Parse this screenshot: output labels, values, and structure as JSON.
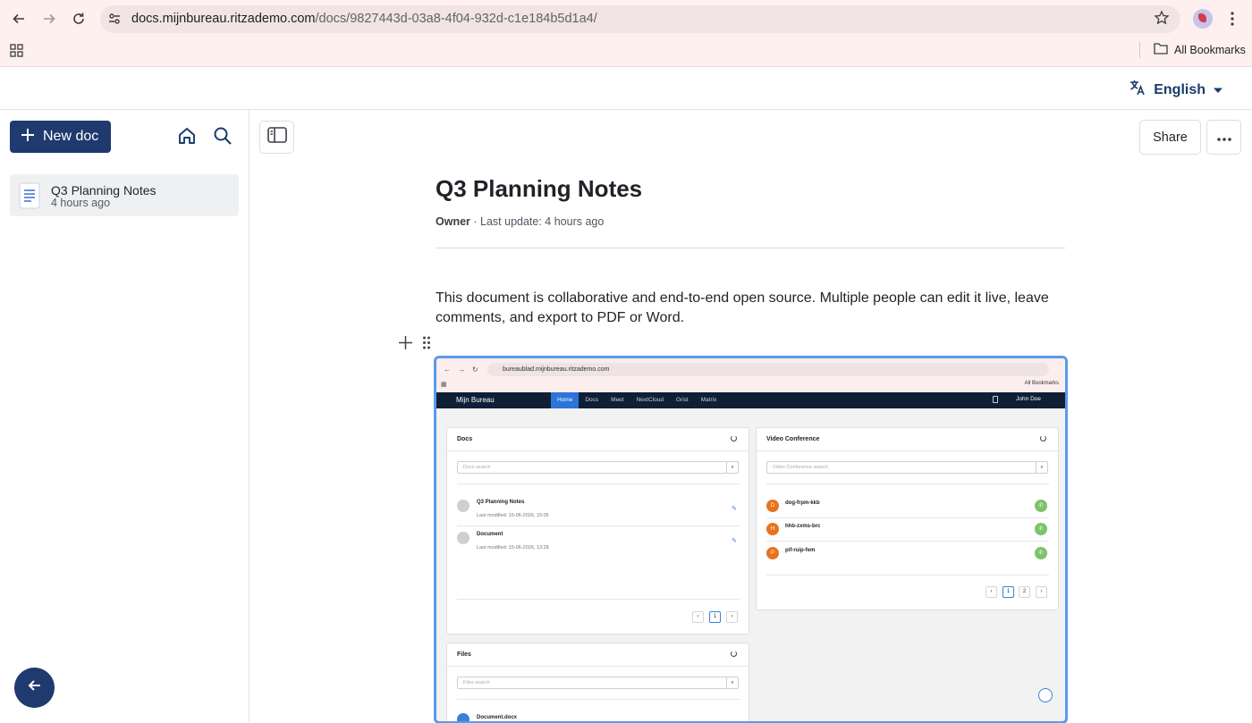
{
  "browser": {
    "url_domain": "docs.mijnbureau.ritzademo.com",
    "url_path": "/docs/9827443d-03a8-4f04-932d-c1e184b5d1a4/",
    "bookmarks_label": "All Bookmarks"
  },
  "header": {
    "language": "English"
  },
  "sidebar": {
    "new_doc_label": "New doc",
    "docs": [
      {
        "title": "Q3 Planning Notes",
        "subtitle": "4 hours ago"
      }
    ]
  },
  "toolbar": {
    "share_label": "Share"
  },
  "document": {
    "title": "Q3 Planning Notes",
    "owner": "Owner",
    "meta": " · Last update: 4 hours ago",
    "paragraph": "This document is collaborative and end-to-end open source. Multiple people can edit it live, leave comments, and export to PDF or Word."
  },
  "embed": {
    "url": "bureaublad.mijnbureau.ritzademo.com",
    "bookmarks": "All Bookmarks",
    "brand": "Mijn Bureau",
    "tabs": [
      "Home",
      "Docs",
      "Meet",
      "NextCloud",
      "Grist",
      "Matrix"
    ],
    "user": "John Doe",
    "docs_card": {
      "title": "Docs",
      "search": "Docs search",
      "items": [
        {
          "title": "Q3 Planning Notes",
          "modified": "Last modified: 15-06-2026, 15:05"
        },
        {
          "title": "Document",
          "modified": "Last modified: 15-06-2026, 13:28"
        }
      ],
      "pages": [
        "1"
      ]
    },
    "video_card": {
      "title": "Video Conference",
      "search": "Video Conference search",
      "rooms": [
        {
          "initial": "D",
          "name": "dog-frpm-kkb"
        },
        {
          "initial": "H",
          "name": "hhb-zxms-brc"
        },
        {
          "initial": "P",
          "name": "pif-ruip-fem"
        }
      ],
      "pages": [
        "1",
        "2"
      ]
    },
    "files_card": {
      "title": "Files",
      "search": "Files search",
      "items": [
        {
          "title": "Document.docx"
        }
      ]
    }
  },
  "colors": {
    "primary": "#1e3a6e",
    "accent": "#5b9ae8",
    "room_orange": "#e8731e",
    "call_green": "#7cc36a"
  }
}
